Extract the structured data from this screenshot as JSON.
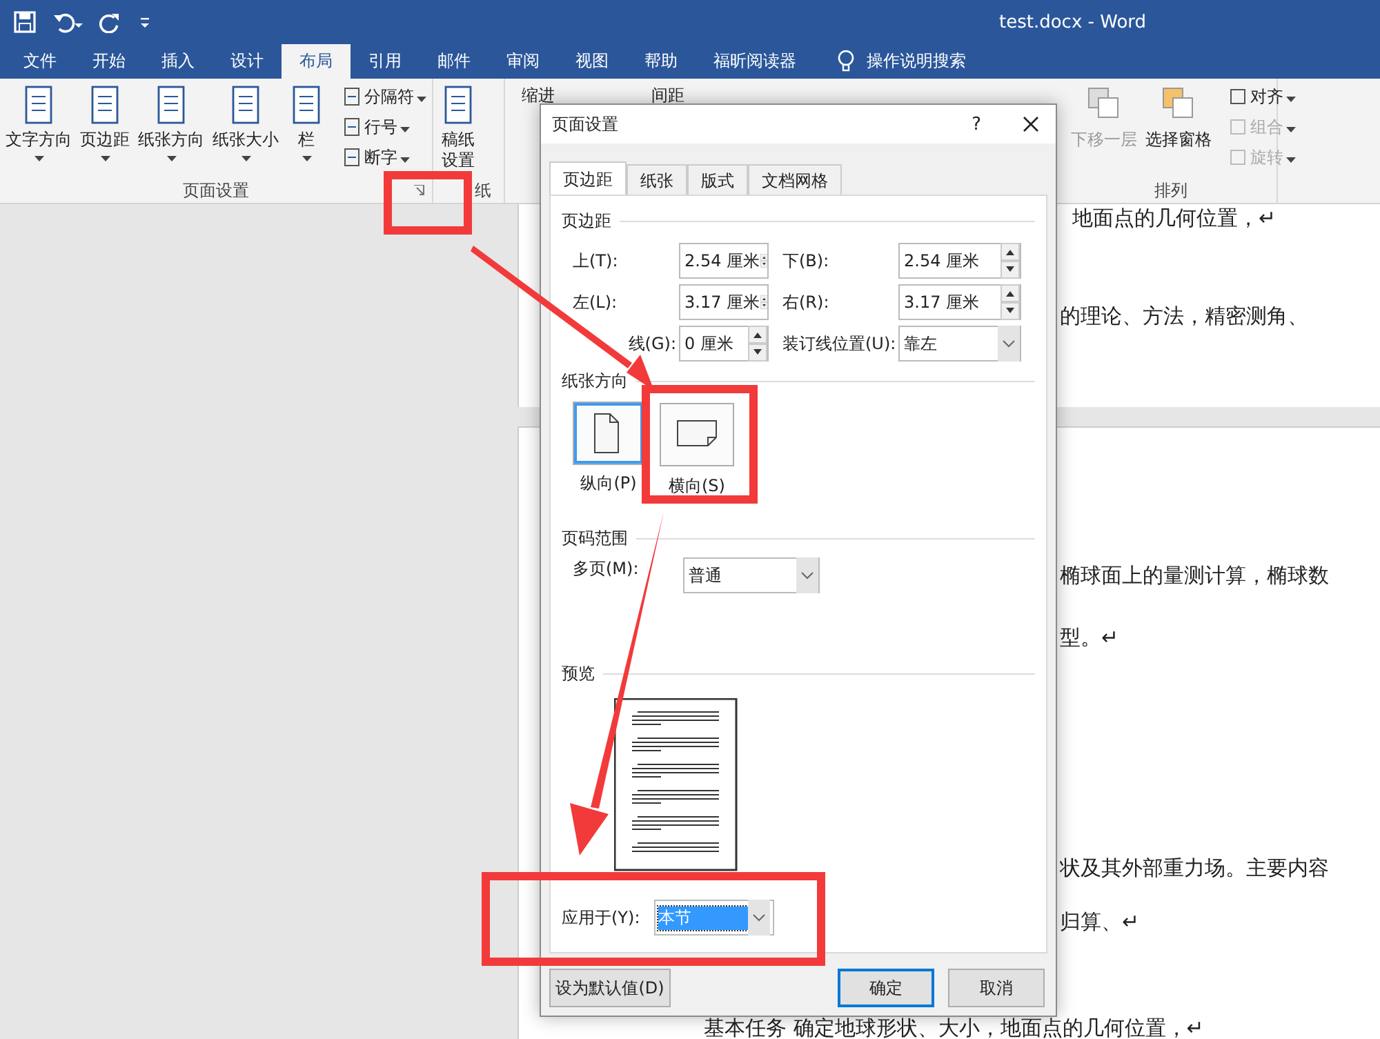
{
  "window": {
    "title": "test.docx  -  Word"
  },
  "ribbon_tabs": [
    {
      "label": "文件",
      "selected": false
    },
    {
      "label": "开始",
      "selected": false
    },
    {
      "label": "插入",
      "selected": false
    },
    {
      "label": "设计",
      "selected": false
    },
    {
      "label": "布局",
      "selected": true
    },
    {
      "label": "引用",
      "selected": false
    },
    {
      "label": "邮件",
      "selected": false
    },
    {
      "label": "审阅",
      "selected": false
    },
    {
      "label": "视图",
      "selected": false
    },
    {
      "label": "帮助",
      "selected": false
    },
    {
      "label": "福昕阅读器",
      "selected": false
    }
  ],
  "tell_me": "操作说明搜索",
  "page_setup_group": {
    "label": "页面设置",
    "large_buttons": [
      {
        "label": "文字方向"
      },
      {
        "label": "页边距"
      },
      {
        "label": "纸张方向"
      },
      {
        "label": "纸张大小"
      },
      {
        "label": "栏"
      }
    ],
    "small_buttons": [
      {
        "label": "分隔符"
      },
      {
        "label": "行号"
      },
      {
        "label": "断字"
      }
    ]
  },
  "draft_group": {
    "label": "纸",
    "button": "稿纸设置"
  },
  "paragraph_group": {
    "indent": "缩进",
    "spacing": "间距"
  },
  "arrange_group": {
    "label": "排列",
    "large_buttons": [
      {
        "label": "下移一层",
        "disabled": true
      },
      {
        "label": "选择窗格",
        "disabled": false
      }
    ],
    "small_buttons": [
      {
        "label": "对齐",
        "disabled": false
      },
      {
        "label": "组合",
        "disabled": true
      },
      {
        "label": "旋转",
        "disabled": true
      }
    ]
  },
  "document": {
    "page_1": [
      "地面点的几何位置，↵",
      "的理论、方法，精密测角、"
    ],
    "page_2": [
      "椭球面上的量测计算，椭球数",
      "型。↵",
      "状及其外部重力场。主要内容",
      "归算、↵",
      "基本任务    确定地球形状、大小，地面点的几何位置，↵"
    ]
  },
  "dialog": {
    "title": "页面设置",
    "help": "?",
    "tabs": [
      {
        "label": "页边距",
        "selected": true
      },
      {
        "label": "纸张",
        "selected": false
      },
      {
        "label": "版式",
        "selected": false
      },
      {
        "label": "文档网格",
        "selected": false
      }
    ],
    "margins": {
      "heading": "页边距",
      "fields": [
        {
          "label": "上(T):",
          "value": "2.54 厘米",
          "kind": "spin"
        },
        {
          "label": "下(B):",
          "value": "2.54 厘米",
          "kind": "spin"
        },
        {
          "label": "左(L):",
          "value": "3.17 厘米",
          "kind": "spin"
        },
        {
          "label": "右(R):",
          "value": "3.17 厘米",
          "kind": "spin"
        },
        {
          "label": "线(G):",
          "value": "0 厘米",
          "kind": "spin"
        },
        {
          "label": "装订线位置(U):",
          "value": "靠左",
          "kind": "combo"
        }
      ]
    },
    "orientation": {
      "heading": "纸张方向",
      "options": [
        {
          "label": "纵向(P)",
          "kind": "portrait",
          "selected": true
        },
        {
          "label": "横向(S)",
          "kind": "landscape",
          "selected": false
        }
      ]
    },
    "pages": {
      "heading": "页码范围",
      "label": "多页(M):",
      "value": "普通"
    },
    "preview": {
      "heading": "预览"
    },
    "apply_to": {
      "label": "应用于(Y):",
      "value": "本节"
    },
    "buttons": [
      {
        "label": "设为默认值(D)",
        "kind": "default"
      },
      {
        "label": "确定",
        "kind": "primary"
      },
      {
        "label": "取消",
        "kind": "normal"
      }
    ]
  }
}
